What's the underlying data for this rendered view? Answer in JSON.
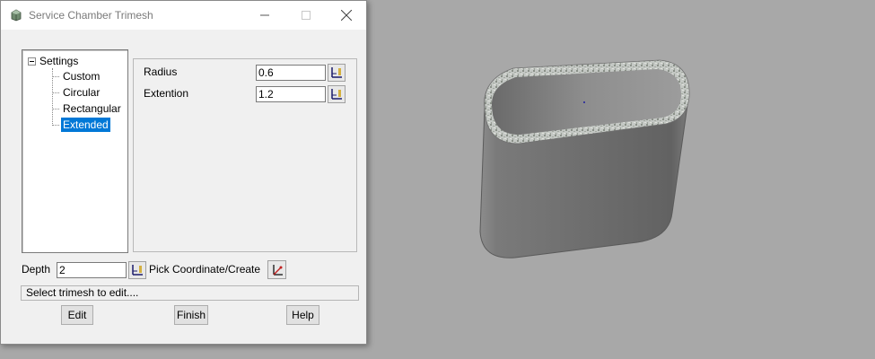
{
  "dialog": {
    "title": "Service Chamber Trimesh",
    "tree": {
      "root": "Settings",
      "items": [
        {
          "label": "Custom",
          "selected": false
        },
        {
          "label": "Circular",
          "selected": false
        },
        {
          "label": "Rectangular",
          "selected": false
        },
        {
          "label": "Extended",
          "selected": true
        }
      ]
    },
    "fields": {
      "radius": {
        "label": "Radius",
        "value": "0.6"
      },
      "extention": {
        "label": "Extention",
        "value": "1.2"
      },
      "depth": {
        "label": "Depth",
        "value": "2"
      }
    },
    "pick_label": "Pick Coordinate/Create",
    "status": "Select trimesh to edit....",
    "buttons": {
      "edit": "Edit",
      "finish": "Finish",
      "help": "Help"
    }
  },
  "icons": {
    "app": "trimesh-app-icon",
    "pick": "pick-value-icon",
    "coordinate": "pick-coordinate-icon"
  },
  "colors": {
    "selection": "#0078d7",
    "viewport_background": "#a8a8a8",
    "dialog_background": "#f0f0f0"
  }
}
